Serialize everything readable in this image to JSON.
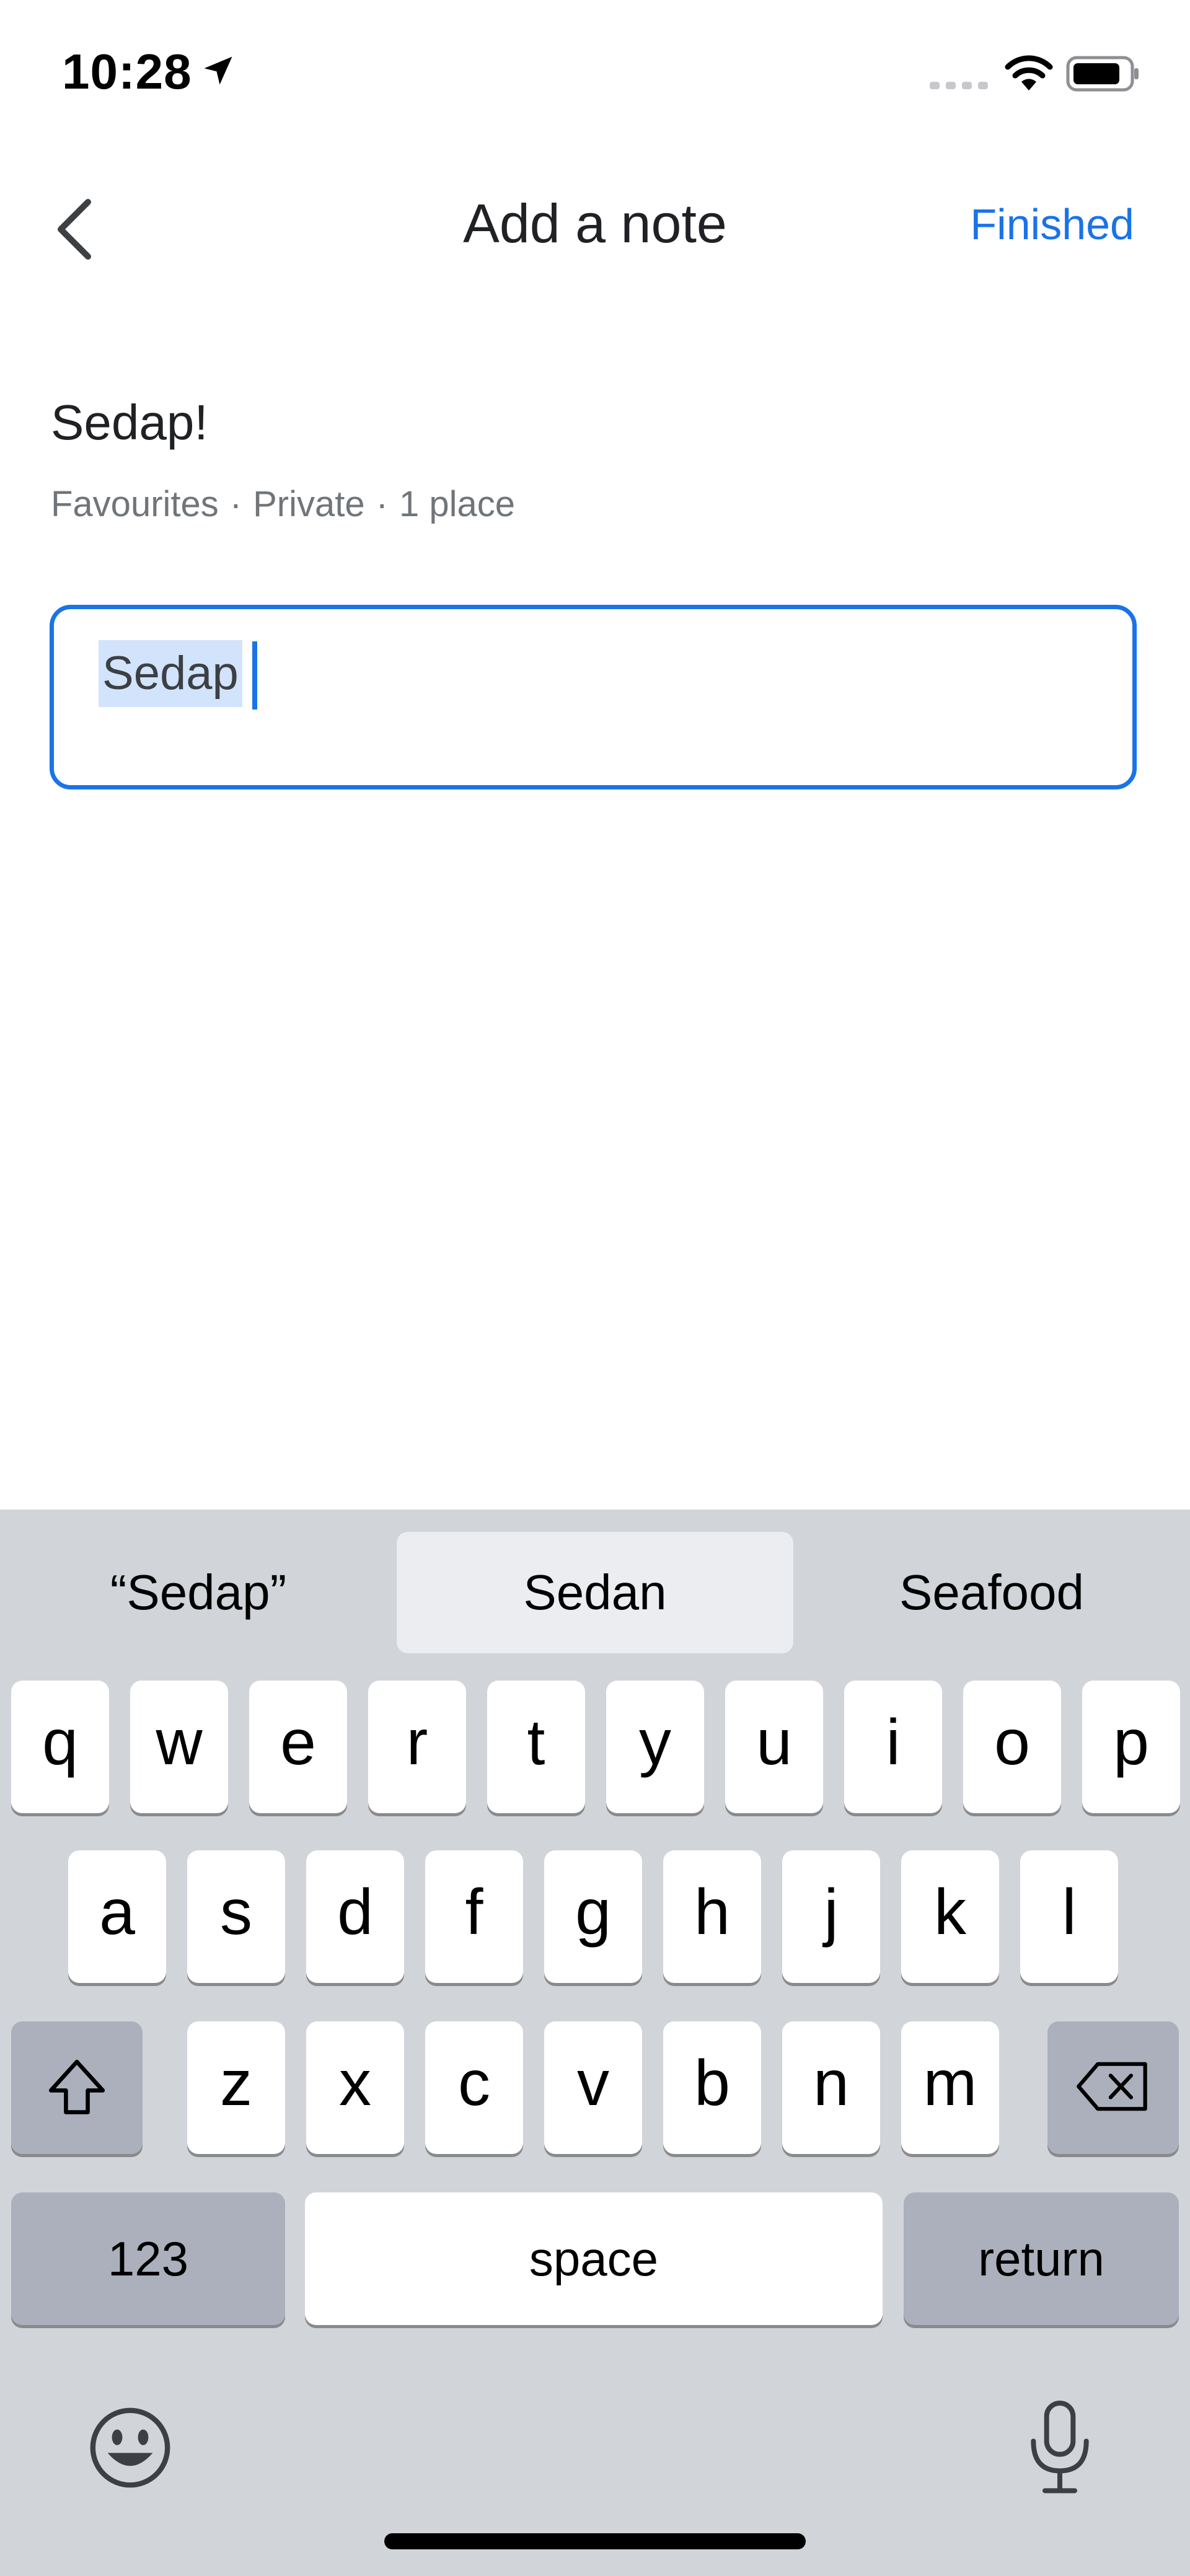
{
  "status_bar": {
    "time": "10:28"
  },
  "header": {
    "title": "Add a note",
    "finished_label": "Finished"
  },
  "list": {
    "name": "Sedap!",
    "meta": [
      "Favourites",
      "Private",
      "1 place"
    ],
    "separator": "·"
  },
  "note_field": {
    "value": "Sedap"
  },
  "keyboard": {
    "suggestions": [
      "“Sedap”",
      "Sedan",
      "Seafood"
    ],
    "row1": [
      "q",
      "w",
      "e",
      "r",
      "t",
      "y",
      "u",
      "i",
      "o",
      "p"
    ],
    "row2": [
      "a",
      "s",
      "d",
      "f",
      "g",
      "h",
      "j",
      "k",
      "l"
    ],
    "row3": [
      "z",
      "x",
      "c",
      "v",
      "b",
      "n",
      "m"
    ],
    "numbers_label": "123",
    "space_label": "space",
    "return_label": "return"
  },
  "colors": {
    "accent": "#1a73e8",
    "keyboard_bg": "#d1d4d9",
    "key_dark": "#abb0bc",
    "selection": "#d2e3fc"
  },
  "icons": [
    "location-arrow-icon",
    "signal-icon",
    "wifi-icon",
    "battery-icon",
    "back-arrow-icon",
    "shift-icon",
    "backspace-icon",
    "emoji-icon",
    "microphone-icon"
  ]
}
